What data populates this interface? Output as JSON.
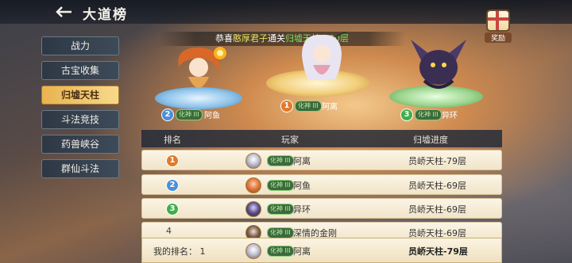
{
  "header": {
    "title": "大道榜",
    "reward_label": "奖励"
  },
  "sidebar": {
    "items": [
      {
        "label": "战力",
        "active": false
      },
      {
        "label": "古宝收集",
        "active": false
      },
      {
        "label": "归墟天柱",
        "active": true
      },
      {
        "label": "斗法竞技",
        "active": false
      },
      {
        "label": "药兽峡谷",
        "active": false
      },
      {
        "label": "群仙斗法",
        "active": false
      }
    ]
  },
  "announcement": {
    "prefix": "恭喜",
    "player": "憨厚君子",
    "middle": "通关",
    "stage": "归墟天柱-100层"
  },
  "podium": [
    {
      "rank": "1",
      "tag": "化神 III",
      "name": "阿离"
    },
    {
      "rank": "2",
      "tag": "化神 III",
      "name": "阿鱼"
    },
    {
      "rank": "3",
      "tag": "化神 III",
      "name": "异环"
    }
  ],
  "table": {
    "headers": {
      "rank": "排名",
      "player": "玩家",
      "progress": "归墟进度"
    },
    "rows": [
      {
        "rank": "1",
        "tag": "化神 III",
        "name": "阿离",
        "progress": "员峤天柱-79层"
      },
      {
        "rank": "2",
        "tag": "化神 III",
        "name": "阿鱼",
        "progress": "员峤天柱-69层"
      },
      {
        "rank": "3",
        "tag": "化神 III",
        "name": "异环",
        "progress": "员峤天柱-69层"
      },
      {
        "rank": "4",
        "tag": "化神 III",
        "name": "深情的金刚",
        "progress": "员峤天柱-69层"
      }
    ]
  },
  "my_rank": {
    "label": "我的排名：",
    "value": "1",
    "tag": "化神 III",
    "name": "阿离",
    "progress": "员峤天柱-79层"
  },
  "colors": {
    "active_tab": "#f2c86a",
    "announce_highlight": "#e6e15a",
    "stage_highlight": "#7be35a"
  }
}
